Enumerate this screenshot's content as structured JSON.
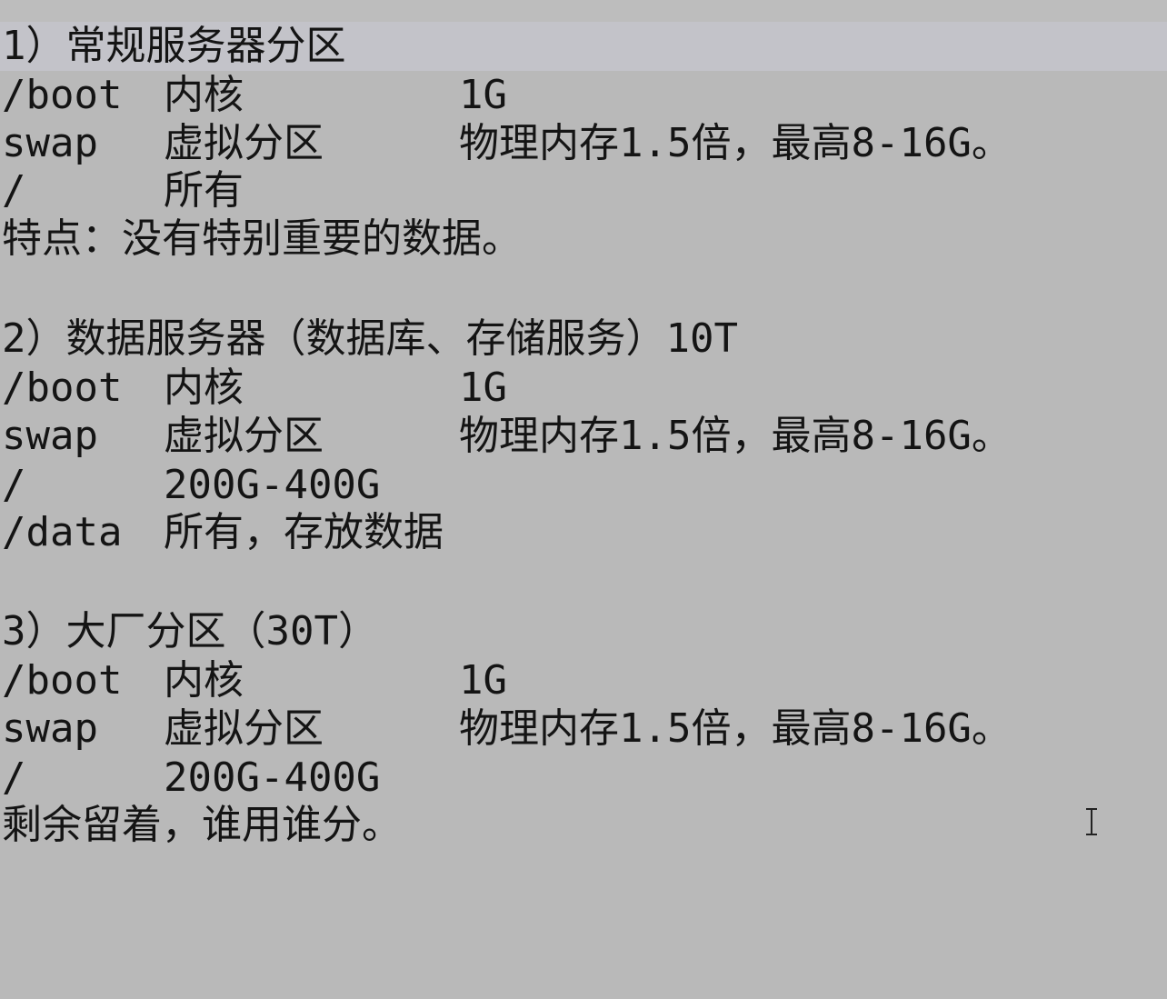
{
  "sections": [
    {
      "heading": "1）常规服务器分区",
      "rows": [
        {
          "path": "/boot",
          "desc": "内核",
          "size": "1G"
        },
        {
          "path": "swap",
          "desc": "虚拟分区",
          "size": "物理内存1.5倍，最高8-16G。"
        },
        {
          "path": "/",
          "desc": "所有",
          "size": ""
        }
      ],
      "note": "特点：没有特别重要的数据。"
    },
    {
      "heading": "2）数据服务器（数据库、存储服务）10T",
      "rows": [
        {
          "path": "/boot",
          "desc": "内核",
          "size": "1G"
        },
        {
          "path": "swap",
          "desc": "虚拟分区",
          "size": "物理内存1.5倍，最高8-16G。"
        },
        {
          "path": "/",
          "desc": "200G-400G",
          "size": ""
        },
        {
          "path": "/data",
          "desc": "所有，存放数据",
          "size": ""
        }
      ]
    },
    {
      "heading": "3）大厂分区（30T）",
      "rows": [
        {
          "path": "/boot",
          "desc": "内核",
          "size": "1G"
        },
        {
          "path": "swap",
          "desc": "虚拟分区",
          "size": "物理内存1.5倍，最高8-16G。"
        },
        {
          "path": "/",
          "desc": "200G-400G",
          "size": ""
        }
      ],
      "note": "剩余留着，谁用谁分。"
    }
  ],
  "cursor_icon": "text-cursor-ibeam-icon",
  "colors": {
    "background": "#b9b9b9",
    "current_line_highlight": "#c3c3c9",
    "text": "#141414"
  }
}
